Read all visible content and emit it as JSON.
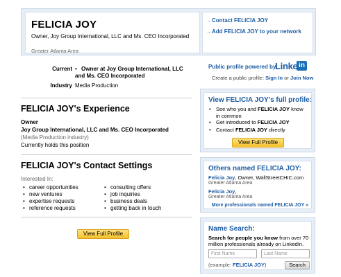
{
  "header": {
    "name": "FELICIA JOY",
    "headline": "Owner, Joy Group International, LLC and Ms. CEO Incorporated",
    "location": "Greater Atlanta Area",
    "links": [
      "Contact FELICIA JOY",
      "Add FELICIA JOY to your network"
    ]
  },
  "summary": {
    "current_label": "Current",
    "current_value": "Owner at Joy Group International, LLC and Ms. CEO Incorporated",
    "industry_label": "Industry",
    "industry_value": "Media Production"
  },
  "experience": {
    "title": "FELICIA JOY's Experience",
    "role": "Owner",
    "company": "Joy Group International, LLC and Ms. CEO Incorporated",
    "industry": "(Media Production industry)",
    "status": "Currently holds this position"
  },
  "contact": {
    "title": "FELICIA JOY's Contact Settings",
    "interested_label": "Interested In:",
    "col1": [
      "career opportunities",
      "new ventures",
      "expertise requests",
      "reference requests"
    ],
    "col2": [
      "consulting offers",
      "job inquiries",
      "business deals",
      "getting back in touch"
    ]
  },
  "view_full_profile_button": "View Full Profile",
  "linkedin": {
    "powered_by": "Public profile powered by:",
    "logo_text": "Linked",
    "logo_in": "in",
    "create_text": "Create a public profile:",
    "sign_in": "Sign In",
    "or_text": "or",
    "join_now": "Join Now"
  },
  "full_profile_box": {
    "title": "View FELICIA JOY's full profile:",
    "items": [
      [
        "See who you and ",
        "FELICIA JOY",
        " know in common"
      ],
      [
        "Get introduced to ",
        "FELICIA JOY",
        ""
      ],
      [
        "Contact ",
        "FELICIA JOY",
        " directly"
      ]
    ],
    "button": "View Full Profile"
  },
  "others_box": {
    "title": "Others named FELICIA JOY:",
    "people": [
      {
        "name": "Felicia Joy",
        "desc": ", Owner, WallStreetCHIC.com",
        "location": "Greater Atlanta Area"
      },
      {
        "name": "Felicia Joy",
        "desc": ",",
        "location": "Greater Atlanta Area"
      }
    ],
    "more_link": "More professionals named FELICIA JOY »"
  },
  "name_search": {
    "title": "Name Search:",
    "desc_bold": "Search for people you know",
    "desc_rest": " from over 70 million professionals already on LinkedIn.",
    "first_placeholder": "First Name",
    "last_placeholder": "Last Name",
    "example_prefix": "(example: ",
    "example_name": "FELICIA JOY",
    "example_suffix": ")",
    "search_button": "Search"
  }
}
